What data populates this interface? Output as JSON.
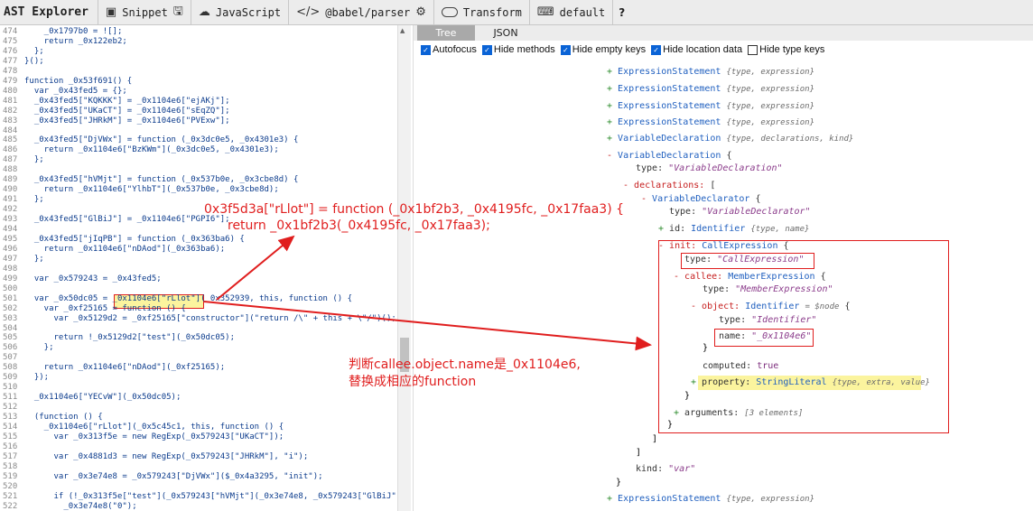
{
  "toolbar": {
    "brand": "AST Explorer",
    "snippet": "Snippet",
    "language": "JavaScript",
    "parser": "@babel/parser",
    "transform": "Transform",
    "keymap": "default",
    "help": "?"
  },
  "code": [
    {
      "n": "474",
      "t": "    _0x1797b0 = ![];"
    },
    {
      "n": "475",
      "t": "    return _0x122eb2;"
    },
    {
      "n": "476",
      "t": "  };"
    },
    {
      "n": "477",
      "t": "}();"
    },
    {
      "n": "478",
      "t": ""
    },
    {
      "n": "479",
      "t": "function _0x53f691() {"
    },
    {
      "n": "480",
      "t": "  var _0x43fed5 = {};"
    },
    {
      "n": "481",
      "t": "  _0x43fed5[\"KQKKK\"] = _0x1104e6[\"ejAKj\"];"
    },
    {
      "n": "482",
      "t": "  _0x43fed5[\"UKaCT\"] = _0x1104e6[\"sEqZQ\"];"
    },
    {
      "n": "483",
      "t": "  _0x43fed5[\"JHRkM\"] = _0x1104e6[\"PVExw\"];"
    },
    {
      "n": "484",
      "t": ""
    },
    {
      "n": "485",
      "t": "  _0x43fed5[\"DjVWx\"] = function (_0x3dc0e5, _0x4301e3) {"
    },
    {
      "n": "486",
      "t": "    return _0x1104e6[\"BzKWm\"](_0x3dc0e5, _0x4301e3);"
    },
    {
      "n": "487",
      "t": "  };"
    },
    {
      "n": "488",
      "t": ""
    },
    {
      "n": "489",
      "t": "  _0x43fed5[\"hVMjt\"] = function (_0x537b0e, _0x3cbe8d) {"
    },
    {
      "n": "490",
      "t": "    return _0x1104e6[\"YlhbT\"](_0x537b0e, _0x3cbe8d);"
    },
    {
      "n": "491",
      "t": "  };"
    },
    {
      "n": "492",
      "t": ""
    },
    {
      "n": "493",
      "t": "  _0x43fed5[\"GlBiJ\"] = _0x1104e6[\"PGPI6\"];"
    },
    {
      "n": "494",
      "t": ""
    },
    {
      "n": "495",
      "t": "  _0x43fed5[\"jIqPB\"] = function (_0x363ba6) {"
    },
    {
      "n": "496",
      "t": "    return _0x1104e6[\"nDAod\"](_0x363ba6);"
    },
    {
      "n": "497",
      "t": "  };"
    },
    {
      "n": "498",
      "t": ""
    },
    {
      "n": "499",
      "t": "  var _0x579243 = _0x43fed5;"
    },
    {
      "n": "500",
      "t": ""
    },
    {
      "n": "501",
      "t": "  var _0x50dc05 = _0x1104e6[\"rLlot\"](_0x352939, this, function () {"
    },
    {
      "n": "502",
      "t": "    var _0xf25165 = function () {"
    },
    {
      "n": "503",
      "t": "      var _0x5129d2 = _0xf25165[\"constructor\"](\"return /\\\" + this + \\\"/\")();"
    },
    {
      "n": "504",
      "t": ""
    },
    {
      "n": "505",
      "t": "      return !_0x5129d2[\"test\"](_0x50dc05);"
    },
    {
      "n": "506",
      "t": "    };"
    },
    {
      "n": "507",
      "t": ""
    },
    {
      "n": "508",
      "t": "    return _0x1104e6[\"nDAod\"](_0xf25165);"
    },
    {
      "n": "509",
      "t": "  });"
    },
    {
      "n": "510",
      "t": ""
    },
    {
      "n": "511",
      "t": "  _0x1104e6[\"YECvW\"](_0x50dc05);"
    },
    {
      "n": "512",
      "t": ""
    },
    {
      "n": "513",
      "t": "  (function () {"
    },
    {
      "n": "514",
      "t": "    _0x1104e6[\"rLlot\"](_0x5c45c1, this, function () {"
    },
    {
      "n": "515",
      "t": "      var _0x313f5e = new RegExp(_0x579243[\"UKaCT\"]);"
    },
    {
      "n": "516",
      "t": ""
    },
    {
      "n": "517",
      "t": "      var _0x4881d3 = new RegExp(_0x579243[\"JHRkM\"], \"i\");"
    },
    {
      "n": "518",
      "t": ""
    },
    {
      "n": "519",
      "t": "      var _0x3e74e8 = _0x579243[\"DjVWx\"]($_0x4a3295, \"init\");"
    },
    {
      "n": "520",
      "t": ""
    },
    {
      "n": "521",
      "t": "      if (!_0x313f5e[\"test\"](_0x579243[\"hVMjt\"](_0x3e74e8, _0x579243[\"GlBiJ\"]"
    },
    {
      "n": "522",
      "t": "        _0x3e74e8(\"0\");"
    }
  ],
  "tabs": {
    "tree": "Tree",
    "json": "JSON"
  },
  "options": [
    {
      "label": "Autofocus",
      "checked": true
    },
    {
      "label": "Hide methods",
      "checked": true
    },
    {
      "label": "Hide empty keys",
      "checked": true
    },
    {
      "label": "Hide location data",
      "checked": true
    },
    {
      "label": "Hide type keys",
      "checked": false
    }
  ],
  "tree": {
    "expr1": {
      "node": "ExpressionStatement",
      "keys": "{type, expression}"
    },
    "expr2": {
      "node": "ExpressionStatement",
      "keys": "{type, expression}"
    },
    "expr3": {
      "node": "ExpressionStatement",
      "keys": "{type, expression}"
    },
    "expr4": {
      "node": "ExpressionStatement",
      "keys": "{type, expression}"
    },
    "vardecl1": {
      "node": "VariableDeclaration",
      "keys": "{type, declarations, kind}"
    },
    "vardecl2": {
      "node": "VariableDeclaration",
      "brace": "{"
    },
    "type1": {
      "key": "type:",
      "value": "\"VariableDeclaration\""
    },
    "declarations": {
      "key": "declarations:",
      "bracket": "["
    },
    "declarator": {
      "node": "VariableDeclarator",
      "brace": "{"
    },
    "type2": {
      "key": "type:",
      "value": "\"VariableDeclarator\""
    },
    "id": {
      "key": "id:",
      "node": "Identifier",
      "keys": "{type, name}"
    },
    "init": {
      "key": "init:",
      "node": "CallExpression",
      "brace": "{"
    },
    "type3": {
      "key": "type:",
      "value": "\"CallExpression\""
    },
    "callee": {
      "key": "callee:",
      "node": "MemberExpression",
      "brace": "{"
    },
    "type4": {
      "key": "type:",
      "value": "\"MemberExpression\""
    },
    "object": {
      "key": "object:",
      "node": "Identifier",
      "extra": "= $node",
      "brace": "{"
    },
    "type5": {
      "key": "type:",
      "value": "\"Identifier\""
    },
    "name": {
      "key": "name:",
      "value": "\"_0x1104e6\""
    },
    "close1": "}",
    "computed": {
      "key": "computed:",
      "value": "true"
    },
    "property": {
      "key": "property:",
      "node": "StringLiteral",
      "keys": "{type, extra, value}"
    },
    "close2": "}",
    "arguments": {
      "key": "arguments:",
      "value": "[3 elements]"
    },
    "close3": "}",
    "close4": "]",
    "kind": {
      "key": "kind:",
      "value": "\"var\""
    },
    "close5": "}",
    "expr5": {
      "node": "ExpressionStatement",
      "keys": "{type, expression}"
    }
  },
  "annotations": {
    "note1_line1": "0x3f5d3a[\"rLlot\"] = function (_0x1bf2b3, _0x4195fc, _0x17faa3) {",
    "note1_line2": "return _0x1bf2b3(_0x4195fc, _0x17faa3);",
    "note2_line1": "判断callee.object.name是_0x1104e6,",
    "note2_line2": "替换成相应的function"
  },
  "colors": {
    "highlight_red": "#e01e1e",
    "highlight_yellow": "#fbf49e",
    "node_blue": "#1f5fbf",
    "key_red": "#c61e1e"
  }
}
